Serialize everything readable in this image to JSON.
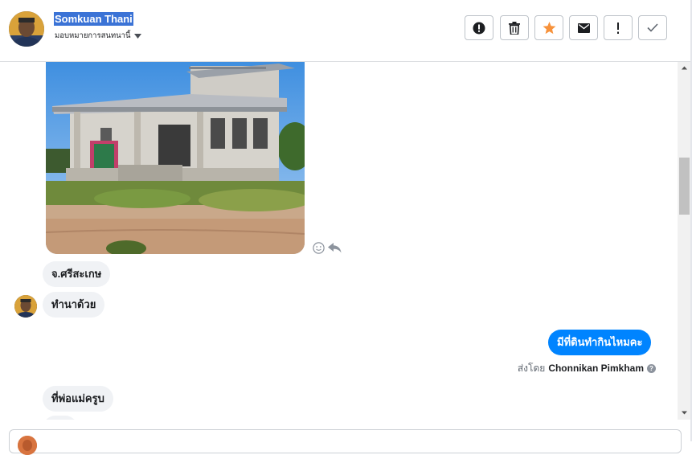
{
  "header": {
    "contact_name": "Somkuan Thani",
    "assign_label": "มอบหมายการสนทนานี้"
  },
  "toolbar": {
    "buttons": [
      {
        "name": "spam-button",
        "icon": "exclamation-circle-icon"
      },
      {
        "name": "delete-button",
        "icon": "trash-icon"
      },
      {
        "name": "star-button",
        "icon": "star-icon",
        "color": "#f7923b"
      },
      {
        "name": "mark-unread-button",
        "icon": "envelope-icon"
      },
      {
        "name": "follow-up-button",
        "icon": "exclamation-icon"
      },
      {
        "name": "mark-done-button",
        "icon": "checkmark-icon"
      }
    ]
  },
  "thread": {
    "messages": [
      {
        "direction": "incoming",
        "type": "image"
      },
      {
        "direction": "incoming",
        "text": "จ.ศรีสะเกษ"
      },
      {
        "direction": "incoming",
        "text": "ทำนาด้วย"
      },
      {
        "direction": "outgoing",
        "text": "มีที่ดินทำกินไหมคะ"
      },
      {
        "direction": "incoming",
        "text": "ที่พ่อแม่ครูบ"
      }
    ],
    "sent_by_prefix": "ส่งโดย",
    "sent_by_agent": "Chonnikan Pimkham"
  },
  "colors": {
    "accent": "#0084ff",
    "incoming_bubble": "#f0f2f5",
    "star": "#f7923b",
    "name_highlight": "#3b73d6"
  }
}
